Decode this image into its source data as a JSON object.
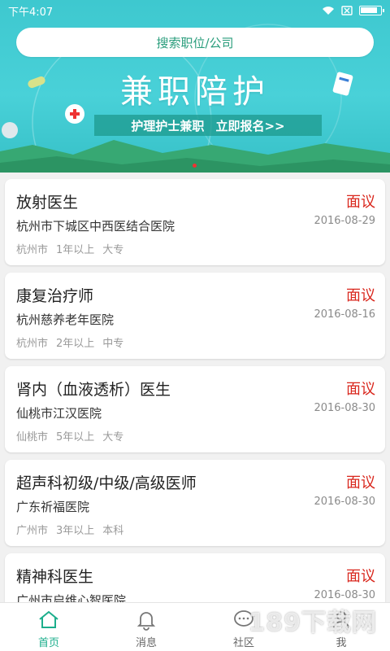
{
  "status_bar": {
    "time": "下午4:07"
  },
  "search": {
    "label": "搜索职位/公司"
  },
  "banner": {
    "title": "兼职陪护",
    "cta_left": "护理护士兼职",
    "cta_right": "立即报名>>"
  },
  "jobs": [
    {
      "title": "放射医生",
      "salary": "面议",
      "hospital": "杭州市下城区中西医结合医院",
      "date": "2016-08-29",
      "city": "杭州市",
      "experience": "1年以上",
      "education": "大专"
    },
    {
      "title": "康复治疗师",
      "salary": "面议",
      "hospital": "杭州慈养老年医院",
      "date": "2016-08-16",
      "city": "杭州市",
      "experience": "2年以上",
      "education": "中专"
    },
    {
      "title": "肾内（血液透析）医生",
      "salary": "面议",
      "hospital": "仙桃市江汉医院",
      "date": "2016-08-30",
      "city": "仙桃市",
      "experience": "5年以上",
      "education": "大专"
    },
    {
      "title": "超声科初级/中级/高级医师",
      "salary": "面议",
      "hospital": "广东祈福医院",
      "date": "2016-08-30",
      "city": "广州市",
      "experience": "3年以上",
      "education": "本科"
    },
    {
      "title": "精神科医生",
      "salary": "面议",
      "hospital": "广州市启维心智医院",
      "date": "2016-08-30",
      "city": "",
      "experience": "",
      "education": ""
    }
  ],
  "tabs": [
    {
      "label": "首页",
      "icon": "home-icon"
    },
    {
      "label": "消息",
      "icon": "bell-icon"
    },
    {
      "label": "社区",
      "icon": "chat-icon"
    },
    {
      "label": "我",
      "icon": "person-icon"
    }
  ],
  "watermark": "189下载网",
  "colors": {
    "accent": "#1cae8c",
    "salary": "#d9261c",
    "banner": "#45cdd4"
  }
}
